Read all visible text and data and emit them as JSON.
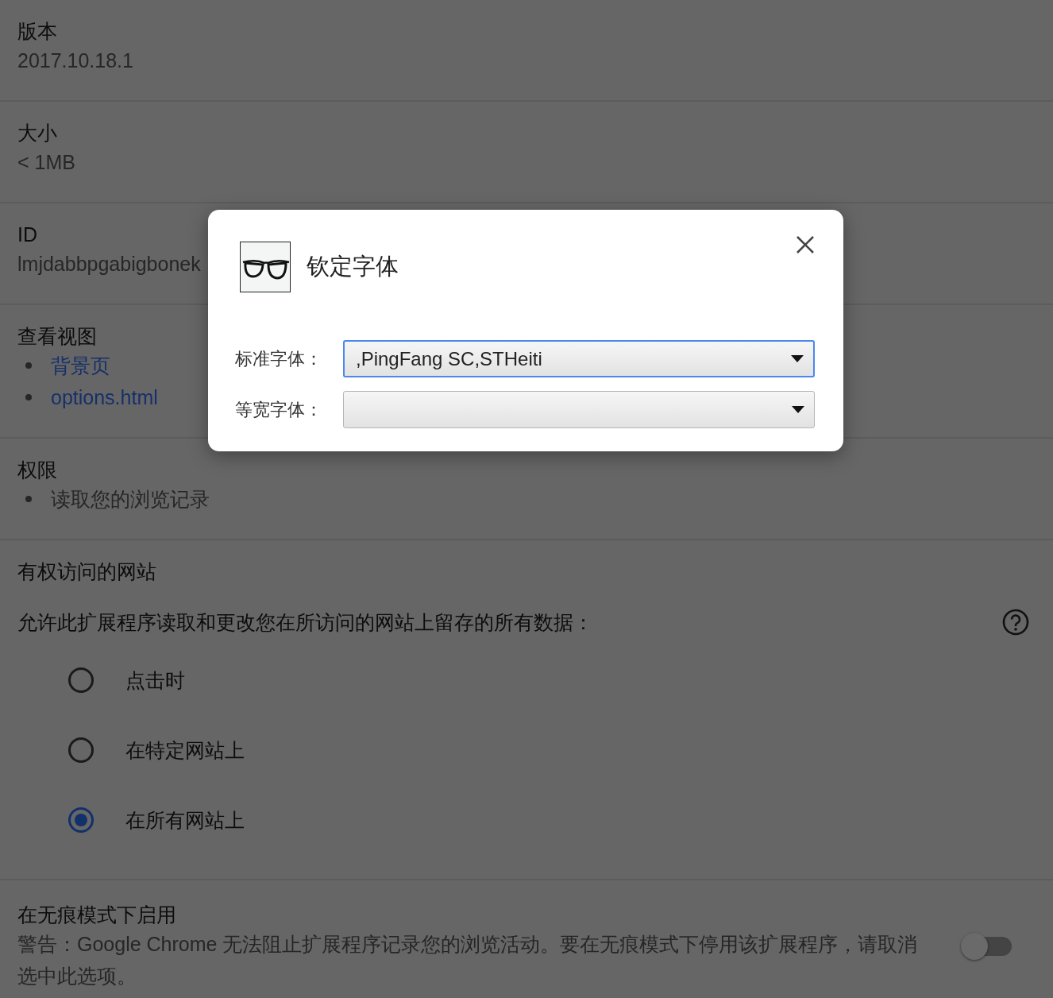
{
  "sections": [
    {
      "kind": "value",
      "title": "版本",
      "value": "2017.10.18.1"
    },
    {
      "kind": "value",
      "title": "大小",
      "value": "< 1MB"
    },
    {
      "kind": "value",
      "title": "ID",
      "value": "lmjdabbpgabigbonek"
    },
    {
      "kind": "links",
      "title": "查看视图",
      "items": [
        "背景页",
        "options.html"
      ]
    },
    {
      "kind": "list",
      "title": "权限",
      "items": [
        "读取您的浏览记录"
      ]
    }
  ],
  "site_access": {
    "title": "有权访问的网站",
    "prompt": "允许此扩展程序读取和更改您在所访问的网站上留存的所有数据：",
    "options": [
      {
        "label": "点击时",
        "selected": false
      },
      {
        "label": "在特定网站上",
        "selected": false
      },
      {
        "label": "在所有网站上",
        "selected": true
      }
    ]
  },
  "incognito": {
    "title": "在无痕模式下启用",
    "warning": "警告：Google Chrome 无法阻止扩展程序记录您的浏览活动。要在无痕模式下停用该扩展程序，请取消选中此选项。",
    "on": false
  },
  "dialog": {
    "title": "钦定字体",
    "fields": [
      {
        "label": "标准字体：",
        "value": ",PingFang SC,STHeiti",
        "focused": true
      },
      {
        "label": "等宽字体：",
        "focused": false
      }
    ]
  }
}
